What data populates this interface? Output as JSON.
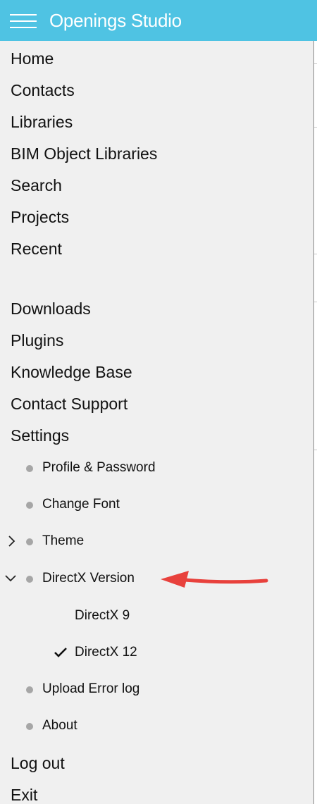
{
  "header": {
    "app_title": "Openings Studio",
    "background": "#4fc3e3",
    "menu_icon": "hamburger-icon"
  },
  "menu": {
    "main_items": [
      {
        "label": "Home"
      },
      {
        "label": "Contacts"
      },
      {
        "label": "Libraries"
      },
      {
        "label": "BIM Object Libraries"
      },
      {
        "label": "Search"
      },
      {
        "label": "Projects"
      },
      {
        "label": "Recent"
      },
      {
        "label": "Downloads"
      },
      {
        "label": "Plugins"
      },
      {
        "label": "Knowledge Base"
      },
      {
        "label": "Contact Support"
      },
      {
        "label": "Settings"
      }
    ],
    "settings_items": [
      {
        "label": "Profile & Password"
      },
      {
        "label": "Change Font"
      },
      {
        "label": "Theme",
        "icon": "chevron-right-icon"
      },
      {
        "label": "DirectX Version",
        "icon": "chevron-down-icon"
      },
      {
        "label": "Upload Error log"
      },
      {
        "label": "About"
      }
    ],
    "directx_options": [
      {
        "label": "DirectX 9",
        "selected": false
      },
      {
        "label": "DirectX 12",
        "selected": true
      }
    ],
    "bottom_items": [
      {
        "label": "Log out"
      },
      {
        "label": "Exit"
      }
    ]
  },
  "annotation": {
    "arrow_color": "#e8413c",
    "points_to": "DirectX Version"
  }
}
